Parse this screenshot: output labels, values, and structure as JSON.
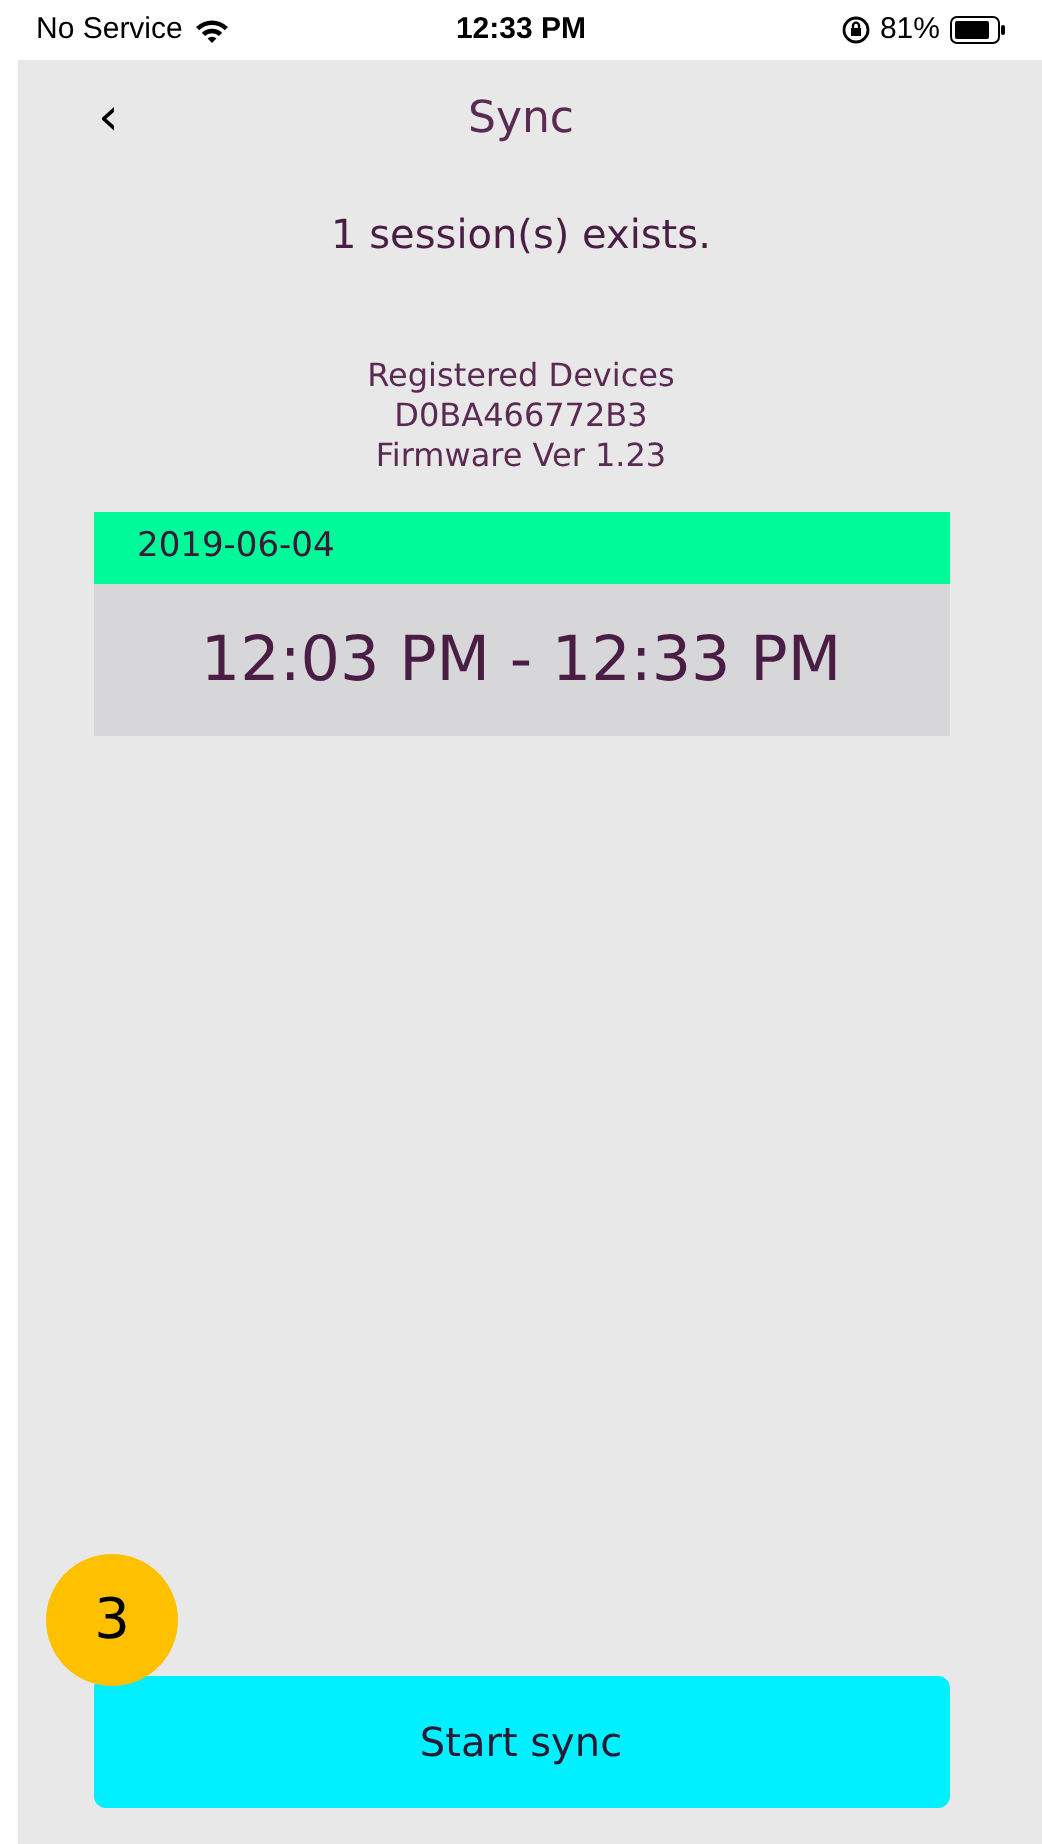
{
  "status_bar": {
    "carrier": "No Service",
    "time": "12:33 PM",
    "battery": "81%"
  },
  "nav": {
    "back": "‹",
    "title": "Sync"
  },
  "session_count": "1 session(s) exists.",
  "device": {
    "label": "Registered Devices",
    "id": "D0BA466772B3",
    "firmware": "Firmware Ver 1.23"
  },
  "sessions": [
    {
      "date": "2019-06-04",
      "range": "12:03 PM - 12:33 PM"
    }
  ],
  "step_badge": "3",
  "start_button": "Start sync"
}
